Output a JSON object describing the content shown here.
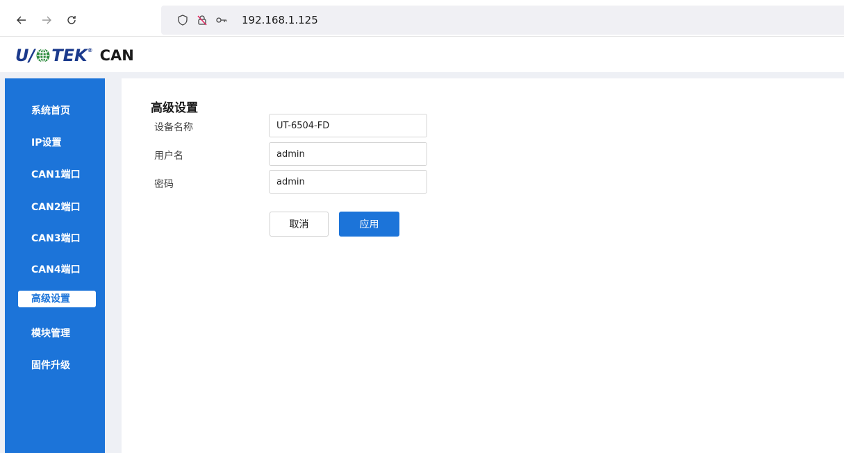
{
  "browser": {
    "url": "192.168.1.125"
  },
  "header": {
    "logo_text_left": "U",
    "logo_text_right": "TEK",
    "logo_reg": "®",
    "product": "CAN"
  },
  "sidebar": {
    "items": [
      {
        "label": "系统首页",
        "active": false
      },
      {
        "label": "IP设置",
        "active": false
      },
      {
        "label": "CAN1端口",
        "active": false
      },
      {
        "label": "CAN2端口",
        "active": false
      },
      {
        "label": "CAN3端口",
        "active": false
      },
      {
        "label": "CAN4端口",
        "active": false
      },
      {
        "label": "高级设置",
        "active": true
      },
      {
        "label": "模块管理",
        "active": false
      },
      {
        "label": "固件升级",
        "active": false
      }
    ]
  },
  "main": {
    "title": "高级设置",
    "fields": [
      {
        "label": "设备名称",
        "value": "UT-6504-FD"
      },
      {
        "label": "用户名",
        "value": "admin"
      },
      {
        "label": "密码",
        "value": "admin"
      }
    ],
    "cancel_label": "取消",
    "apply_label": "应用"
  },
  "colors": {
    "accent": "#1c74d9",
    "logo": "#1b3a8c"
  }
}
